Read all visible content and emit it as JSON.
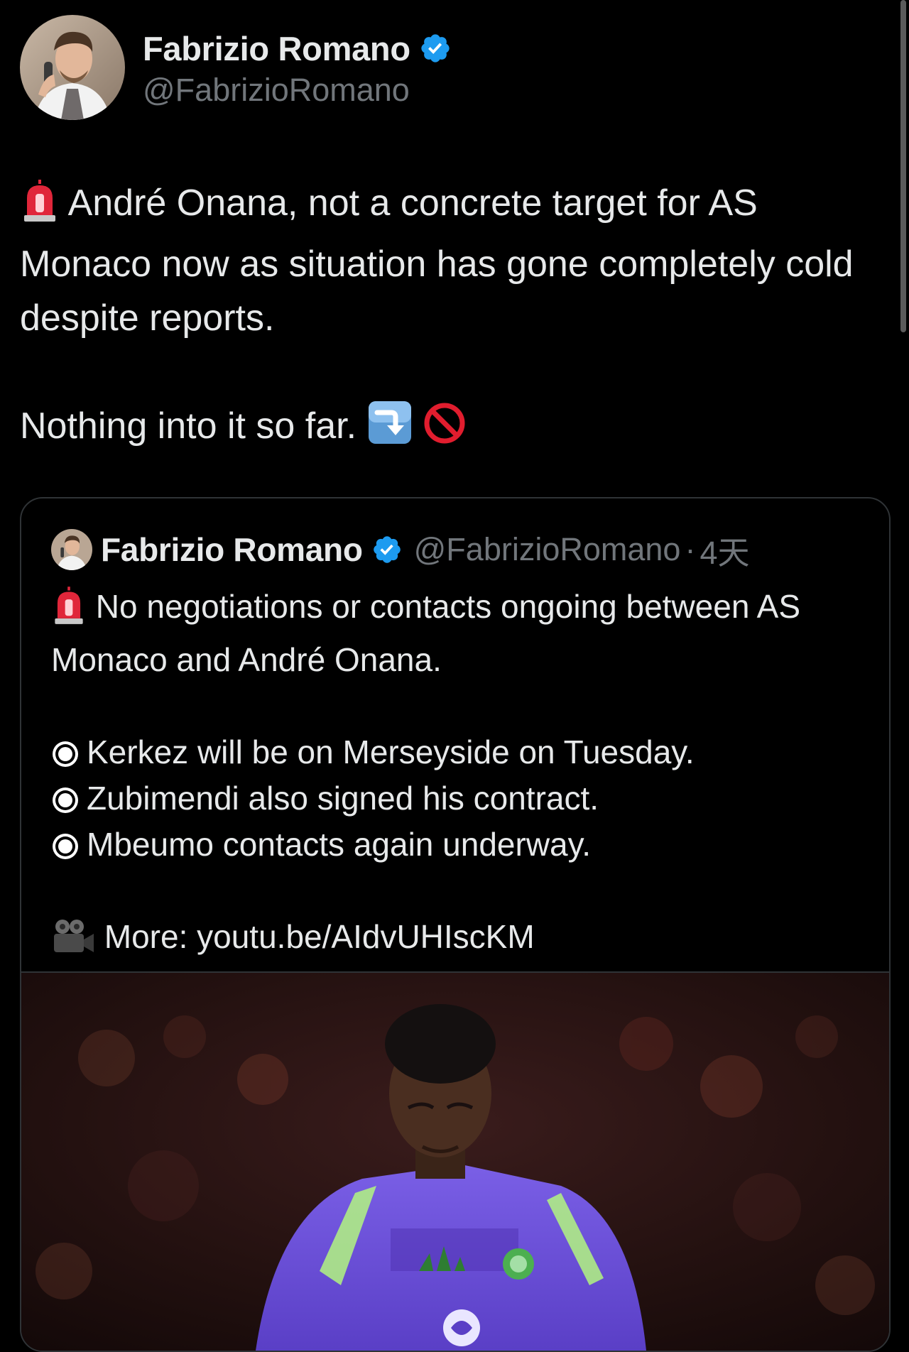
{
  "tweet": {
    "author_name": "Fabrizio Romano",
    "author_handle": "@FabrizioRomano",
    "verified": true,
    "line1_emoji": "siren-icon",
    "line1": "André Onana, not a concrete target for AS Monaco now as situation has gone completely cold despite reports.",
    "line2": "Nothing into it so far.",
    "line2_emojis": [
      "arrow-down-right-icon",
      "prohibited-icon"
    ]
  },
  "quote": {
    "author_name": "Fabrizio Romano",
    "author_handle": "@FabrizioRomano",
    "separator": "·",
    "time": "4天",
    "verified": true,
    "lead_emoji": "siren-icon",
    "lead": "No negotiations or contacts ongoing between AS Monaco and André Onana.",
    "bullets": [
      "Kerkez will be on Merseyside on Tuesday.",
      "Zubimendi also signed his contract.",
      "Mbeumo contacts again underway."
    ],
    "more_emoji": "movie-camera-icon",
    "more_label": "More: youtu.be/AIdvUHIscKM",
    "media": {
      "type": "photo",
      "kit_color": "#6a4fd6",
      "background_color": "#1a0d0f"
    }
  },
  "colors": {
    "background": "#000000",
    "text": "#e7e9ea",
    "secondary_text": "#71767b",
    "verified_blue": "#1d9bf0",
    "border": "#2f3336"
  }
}
